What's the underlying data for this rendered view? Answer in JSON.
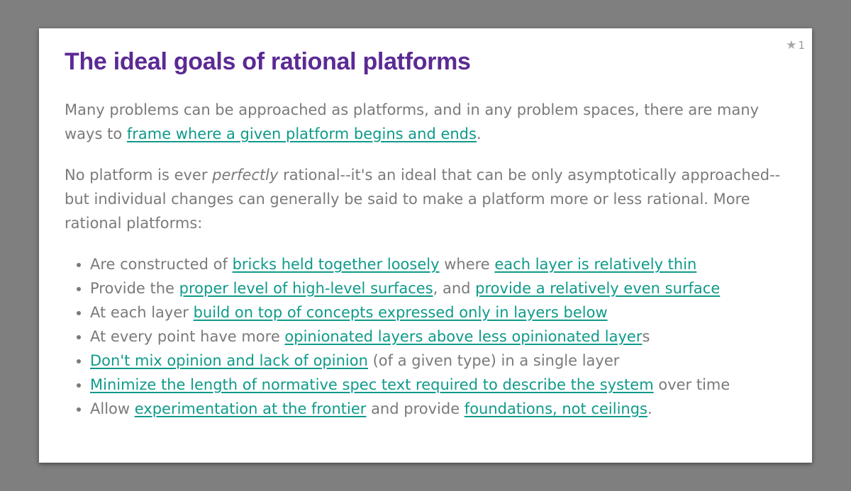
{
  "slide": {
    "title": "The ideal goals of rational platforms",
    "star_count": "1",
    "star_icon": "star-icon"
  },
  "para1": {
    "text_before": "Many problems can be approached as platforms, and in any problem spaces, there are many ways to ",
    "link": "frame where a given platform begins and ends",
    "text_after": "."
  },
  "para2": {
    "text_before": "No platform is ever ",
    "emphasis": "perfectly",
    "text_after": " rational--it's an ideal that can be only asymptotically approached--but individual changes can generally be said to make a platform more or less rational. More rational platforms:"
  },
  "goals": [
    {
      "t1": "Are constructed of ",
      "l1": "bricks held together loosely",
      "t2": " where ",
      "l2": "each layer is relatively thin",
      "t3": ""
    },
    {
      "t1": "Provide the ",
      "l1": "proper level of high-level surfaces",
      "t2": ", and ",
      "l2": "provide a relatively even surface",
      "t3": ""
    },
    {
      "t1": "At each layer ",
      "l1": "build on top of concepts expressed only in layers below",
      "t2": ""
    },
    {
      "t1": "At every point have more ",
      "l1": "opinionated layers above less opinionated layer",
      "t2": "s"
    },
    {
      "t1": "",
      "l1": "Don't mix opinion and lack of opinion",
      "t2": " (of a given type) in a single layer"
    },
    {
      "t1": "",
      "l1": "Minimize the length of normative spec text required to describe the system",
      "t2": " over time"
    },
    {
      "t1": "Allow ",
      "l1": "experimentation at the frontier",
      "t2": " and provide ",
      "l2": "foundations, not ceilings",
      "t3": "."
    }
  ],
  "colors": {
    "background": "#7f7f7f",
    "card": "#ffffff",
    "title": "#5b2a94",
    "body_text": "#7a7a7a",
    "link": "#0f9a8a"
  }
}
